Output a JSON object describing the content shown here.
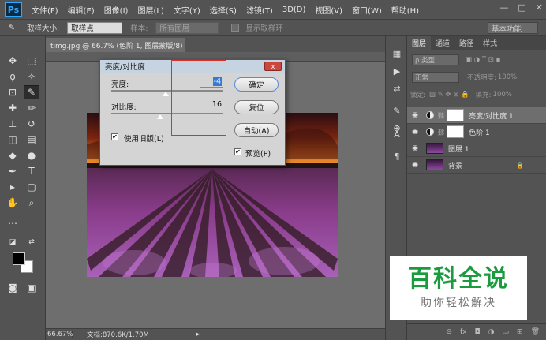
{
  "app": {
    "logo": "Ps"
  },
  "menu": [
    "文件(F)",
    "编辑(E)",
    "图像(I)",
    "图层(L)",
    "文字(Y)",
    "选择(S)",
    "滤镜(T)",
    "3D(D)",
    "视图(V)",
    "窗口(W)",
    "帮助(H)"
  ],
  "window_controls": {
    "minimize": "—",
    "maximize": "□",
    "close": "✕"
  },
  "options_bar": {
    "sample_size_label": "取样大小:",
    "sample_size_value": "取样点",
    "sample_label": "样本:",
    "sample_value": "所有图层",
    "show_ring_label": "显示取样环",
    "workspace": "基本功能"
  },
  "document": {
    "tab_title": "timg.jpg @ 66.7% (色阶 1, 图层蒙版/8) *",
    "tab_close": "✕",
    "zoom": "66.67%",
    "status": "文档:870.6K/1.70M"
  },
  "dialog": {
    "title": "亮度/对比度",
    "brightness_label": "亮度:",
    "brightness_value": "-4",
    "brightness": -4,
    "contrast_label": "对比度:",
    "contrast_value": "16",
    "contrast": 16,
    "use_legacy_label": "使用旧版(L)",
    "use_legacy_checked": true,
    "ok_label": "确定",
    "reset_label": "复位",
    "auto_label": "自动(A)",
    "preview_label": "预览(P)",
    "preview_checked": true,
    "close_glyph": "x"
  },
  "layers_panel": {
    "tabs": [
      "图层",
      "通道",
      "路径",
      "样式"
    ],
    "filter_kind": "ρ 类型",
    "blend_mode": "正常",
    "opacity_label": "不透明度:",
    "opacity_value": "100%",
    "lock_label": "锁定:",
    "fill_label": "填充:",
    "fill_value": "100%",
    "layers": [
      {
        "name": "亮度/对比度 1",
        "type": "adjustment",
        "selected": true
      },
      {
        "name": "色阶 1",
        "type": "adjustment",
        "selected": false
      },
      {
        "name": "图层 1",
        "type": "image",
        "selected": false
      },
      {
        "name": "背景",
        "type": "image-locked",
        "selected": false
      }
    ],
    "footer_icons": [
      "link-icon",
      "fx-icon",
      "mask-icon",
      "adjustment-icon",
      "folder-icon",
      "new-layer-icon",
      "trash-icon"
    ],
    "footer_glyphs": [
      "⊝",
      "fx",
      "◘",
      "◑",
      "▭",
      "⊞",
      "🗑"
    ]
  },
  "watermark": {
    "title": "百科全说",
    "subtitle": "助你轻松解决"
  },
  "colors": {
    "ui_bg": "#535353",
    "dialog_bg": "#d4d4d4",
    "highlight": "#e0302a",
    "watermark_green": "#1a9b3e"
  }
}
